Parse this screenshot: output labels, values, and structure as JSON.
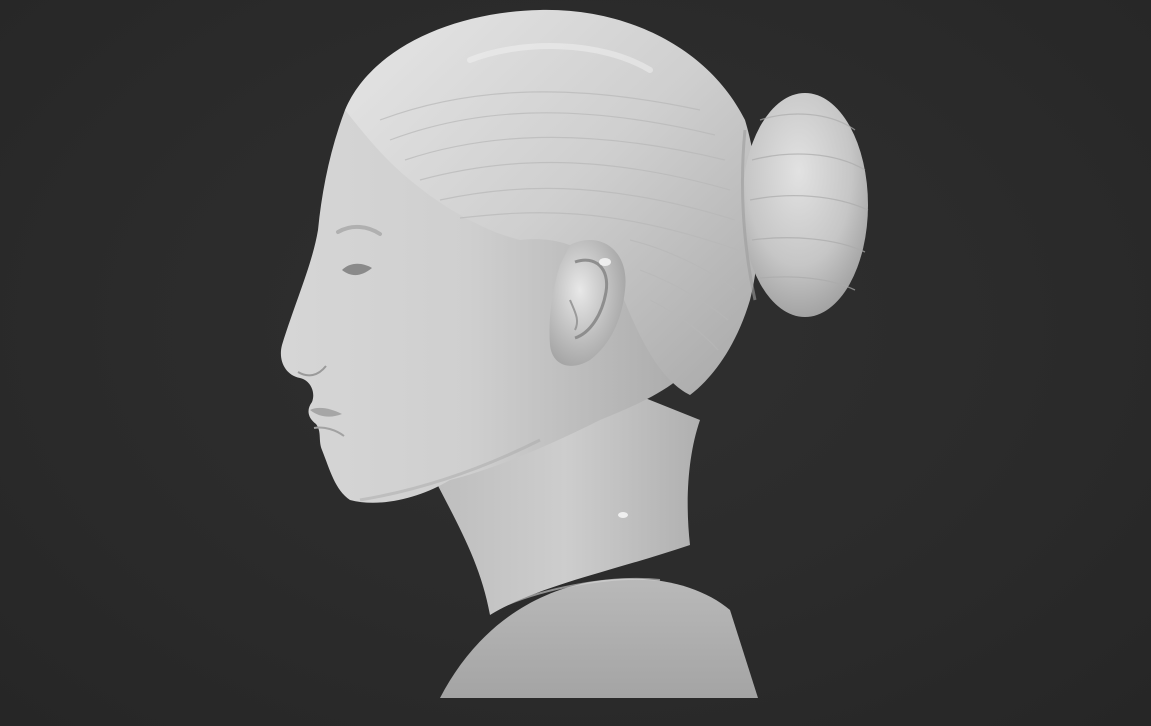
{
  "scene": {
    "background_color": "#2b2b2b",
    "model_color": "#c8c8c8",
    "subject": "sculpt-bust-profile"
  }
}
